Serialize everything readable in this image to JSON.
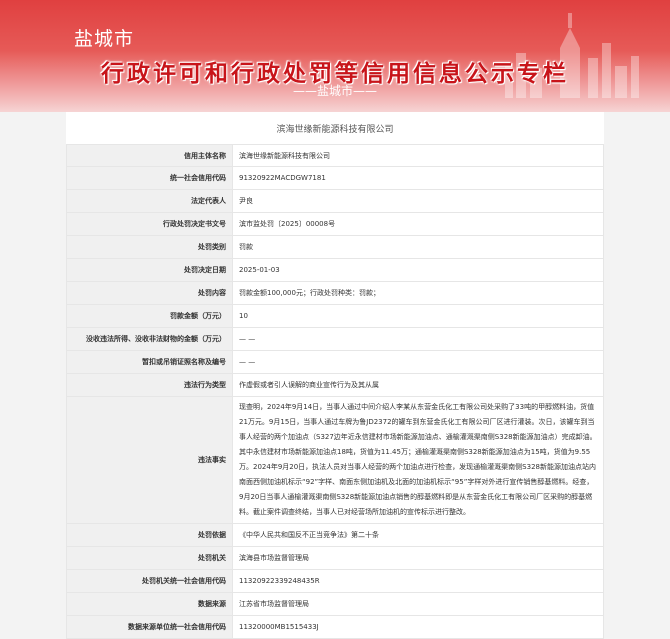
{
  "header": {
    "city": "盐城市",
    "title": "行政许可和行政处罚等信用信息公示专栏",
    "subtitle": "——盐城市——"
  },
  "company_title": "滨海世缘新能源科技有限公司",
  "rows": [
    {
      "label": "信用主体名称",
      "value": "滨海世缘新能源科技有限公司"
    },
    {
      "label": "统一社会信用代码",
      "value": "91320922MACDGW7181"
    },
    {
      "label": "法定代表人",
      "value": "尹良"
    },
    {
      "label": "行政处罚决定书文号",
      "value": "滨市监处罚〔2025〕00008号"
    },
    {
      "label": "处罚类别",
      "value": "罚款"
    },
    {
      "label": "处罚决定日期",
      "value": "2025-01-03"
    },
    {
      "label": "处罚内容",
      "value": "罚款金额100,000元；行政处罚种类：罚款；"
    },
    {
      "label": "罚款金额（万元）",
      "value": "10"
    },
    {
      "label": "没收违法所得、没收非法财物的金额（万元）",
      "value": "— —"
    },
    {
      "label": "暂扣或吊销证照名称及编号",
      "value": "— —"
    },
    {
      "label": "违法行为类型",
      "value": "作虚假或者引人误解的商业宣传行为及其从属"
    },
    {
      "label": "违法事实",
      "value": "现查明，2024年9月14日，当事人通过中间介绍人李某从东营金氏化工有限公司处采购了33吨的甲醇燃料油，货值21万元。9月15日，当事人通过车牌为鲁JD2372的罐车到东营金氏化工有限公司厂区进行灌装。次日，该罐车到当事人经营的两个加油点（S327边年近永信建材市场新能源加油点、通榆灌溉渠南侧S328新能源加油点）完成卸油。其中永信建材市场新能源加油点18吨，货值为11.45万；通榆灌溉渠南侧S328新能源加油点为15吨，货值为9.55万。2024年9月20日，执法人员对当事人经营的两个加油点进行检查，发现通榆灌溉渠南侧S328新能源加油点站内南面西侧加油机标示“92”字样、南面东侧加油机及北面的加油机标示“95”字样对外进行宣传销售醇基燃料。经查，9月20日当事人通榆灌溉渠南侧S328新能源加油点销售的醇基燃料即是从东营金氏化工有限公司厂区采购的醇基燃料。截止案件调查终结，当事人已对经营场所加油机的宣传标示进行整改。"
    },
    {
      "label": "处罚依据",
      "value": "《中华人民共和国反不正当竞争法》第二十条"
    },
    {
      "label": "处罚机关",
      "value": "滨海县市场监督管理局"
    },
    {
      "label": "处罚机关统一社会信用代码",
      "value": "11320922339248435R"
    },
    {
      "label": "数据来源",
      "value": "江苏省市场监督管理局"
    },
    {
      "label": "数据来源单位统一社会信用代码",
      "value": "11320000MB1515433J"
    }
  ]
}
